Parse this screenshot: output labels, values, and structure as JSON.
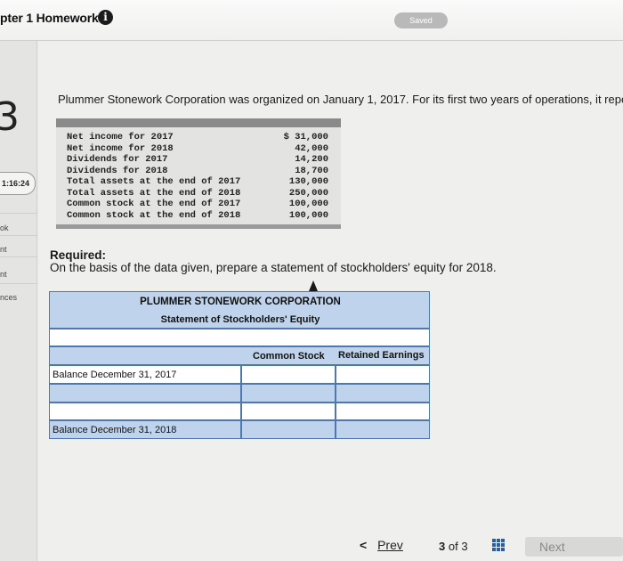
{
  "header": {
    "chapter_title": "pter 1 Homework",
    "info_icon": "i",
    "saved_label": "Saved"
  },
  "rail": {
    "question_number": "3",
    "timer": "1:16:24",
    "labels": [
      "ok",
      "nt",
      "nt",
      "nces"
    ]
  },
  "problem": {
    "text": "Plummer Stonework Corporation was organized on January 1, 2017. For its first two years of operations, it repor",
    "data": [
      {
        "label": "Net income for 2017",
        "value": "$ 31,000"
      },
      {
        "label": "Net income for 2018",
        "value": "42,000"
      },
      {
        "label": "Dividends for 2017",
        "value": "14,200"
      },
      {
        "label": "Dividends for 2018",
        "value": "18,700"
      },
      {
        "label": "Total assets at the end of 2017",
        "value": "130,000"
      },
      {
        "label": "Total assets at the end of 2018",
        "value": "250,000"
      },
      {
        "label": "Common stock at the end of 2017",
        "value": "100,000"
      },
      {
        "label": "Common stock at the end of 2018",
        "value": "100,000"
      }
    ]
  },
  "required": {
    "heading": "Required:",
    "text": "On the basis of the data given, prepare a statement of stockholders' equity for 2018."
  },
  "worksheet": {
    "title": "PLUMMER STONEWORK CORPORATION",
    "subtitle": "Statement of Stockholders' Equity",
    "col_common_stock": "Common Stock",
    "col_retained_earnings": "Retained Earnings",
    "row_balance_2017": "Balance December 31, 2017",
    "row_balance_2018": "Balance December 31, 2018"
  },
  "nav": {
    "prev_chevron": "<",
    "prev_label": "Prev",
    "current_page": "3",
    "of_label": "of",
    "total_pages": "3",
    "next_label": "Next"
  },
  "colors": {
    "worksheet_blue": "#bfd4ec",
    "worksheet_border": "#4e77ae",
    "grid_icon": "#2a5fa8"
  }
}
